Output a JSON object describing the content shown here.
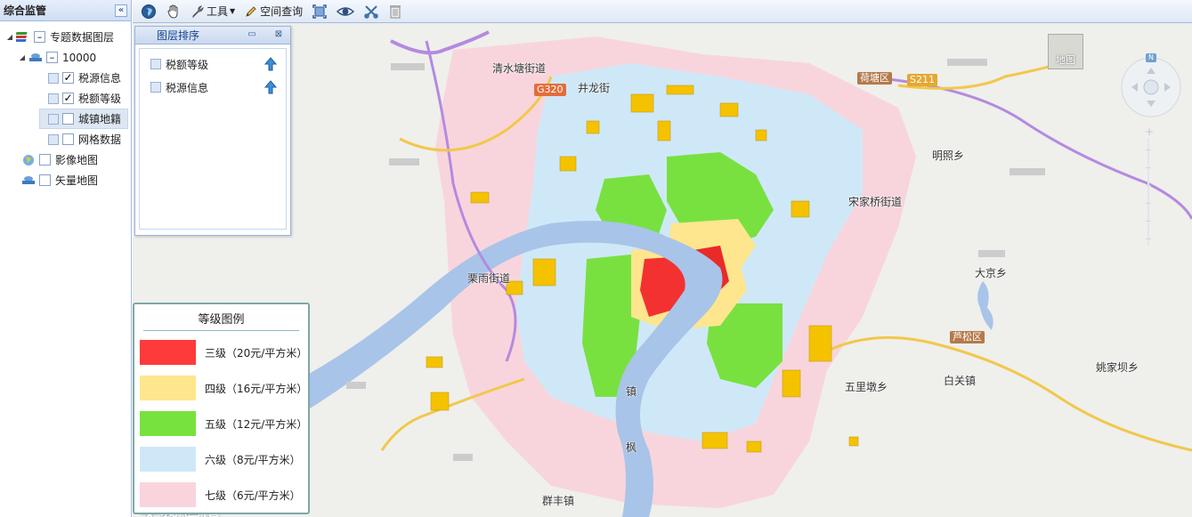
{
  "left_panel": {
    "title": "综合监管",
    "collapse_glyph": "«",
    "tree": {
      "root": {
        "label": "专题数据图层"
      },
      "group": {
        "label": "10000"
      },
      "layers": [
        {
          "label": "税源信息",
          "checked": true
        },
        {
          "label": "税额等级",
          "checked": true
        },
        {
          "label": "城镇地籍",
          "checked": false,
          "selected": true
        },
        {
          "label": "网格数据",
          "checked": false
        }
      ],
      "image_map": {
        "label": "影像地图",
        "icon": "globe-icon"
      },
      "vector_map": {
        "label": "矢量地图",
        "icon": "layers-icon"
      }
    }
  },
  "toolbar": {
    "tools_label": "工具",
    "spatial_query_label": "空间查询"
  },
  "layer_order": {
    "title": "图层排序",
    "min_glyph": "▭",
    "close_glyph": "⊠",
    "items": [
      {
        "label": "税额等级"
      },
      {
        "label": "税源信息"
      }
    ]
  },
  "legend": {
    "title": "等级图例",
    "items": [
      {
        "label": "三级（20元/平方米）",
        "color": "#ff3a3a"
      },
      {
        "label": "四级（16元/平方米）",
        "color": "#fde68d"
      },
      {
        "label": "五级（12元/平方米）",
        "color": "#77e23e"
      },
      {
        "label": "六级（8元/平方米）",
        "color": "#cfe8f8"
      },
      {
        "label": "七级（6元/平方米）",
        "color": "#f9d4dc"
      }
    ]
  },
  "map": {
    "thumbnail_label": "地图",
    "nav_label": "N",
    "places": {
      "qingshuitang": "清水塘街道",
      "jingxu": "井龙街",
      "hetang": "荷塘区",
      "mingzhao": "明照乡",
      "songjiaqiao": "宋家桥街道",
      "liyu": "栗雨街道",
      "dajing": "大京乡",
      "lusong": "芦松区",
      "baiguan": "白关镇",
      "yaojiaba": "姚家坝乡",
      "wulidun": "五里墩乡",
      "qunfeng": "群丰镇",
      "zhen": "镇",
      "feng": "枫"
    },
    "roads": {
      "g320": "G320",
      "s211": "S211"
    }
  },
  "watermark": "大数跨境"
}
